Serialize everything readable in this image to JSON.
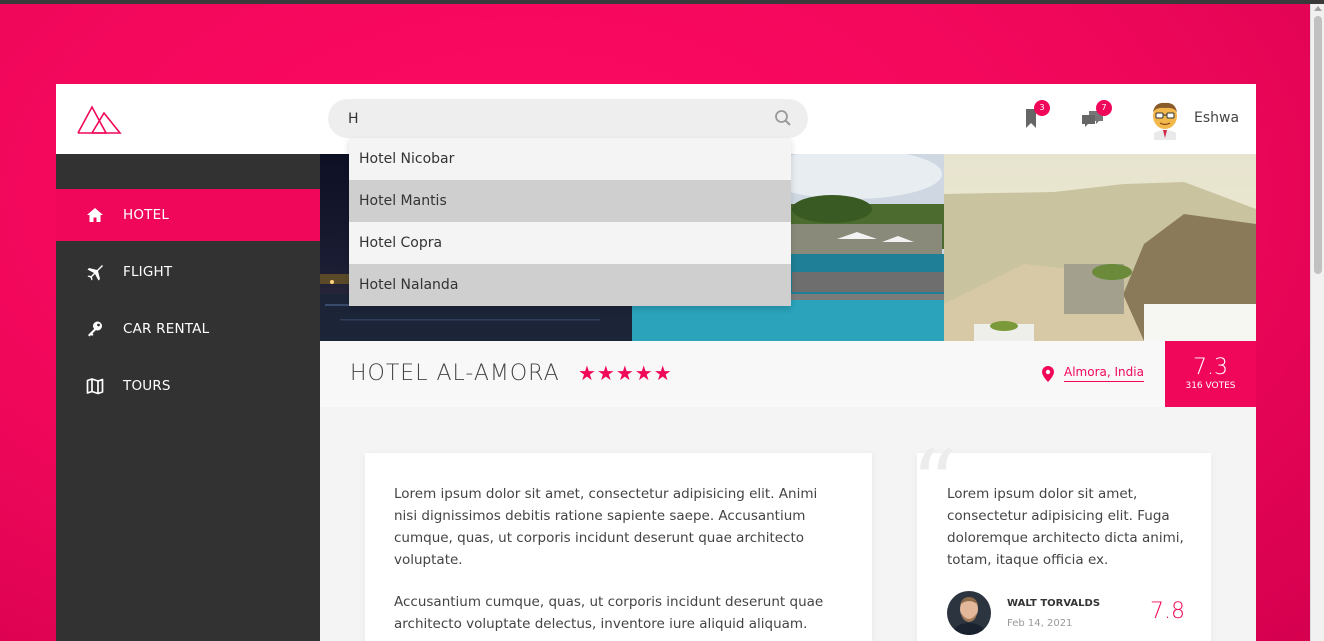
{
  "search": {
    "value": "H",
    "placeholder": ""
  },
  "autocomplete": [
    "Hotel Nicobar",
    "Hotel Mantis",
    "Hotel Copra",
    "Hotel Nalanda"
  ],
  "header": {
    "bookmarks_count": "3",
    "messages_count": "7",
    "username": "Eshwa"
  },
  "sidebar": {
    "items": [
      {
        "label": "HOTEL",
        "icon": "home-icon",
        "active": true
      },
      {
        "label": "FLIGHT",
        "icon": "plane-icon",
        "active": false
      },
      {
        "label": "CAR RENTAL",
        "icon": "key-icon",
        "active": false
      },
      {
        "label": "TOURS",
        "icon": "map-icon",
        "active": false
      }
    ]
  },
  "hotel": {
    "name": "HOTEL AL-AMORA",
    "stars": "★★★★★",
    "star_count": 5,
    "location": "Almora, India",
    "rating": "7.3",
    "votes": "316 VOTES"
  },
  "description": {
    "p1": "Lorem ipsum dolor sit amet, consectetur adipisicing elit. Animi nisi dignissimos debitis ratione sapiente saepe. Accusantium cumque, quas, ut corporis incidunt deserunt quae architecto voluptate.",
    "p2": "Accusantium cumque, quas, ut corporis incidunt deserunt quae architecto voluptate delectus, inventore iure aliquid aliquam."
  },
  "review": {
    "text": "Lorem ipsum dolor sit amet, consectetur adipisicing elit. Fuga doloremque architecto dicta animi, totam, itaque officia ex.",
    "reviewer": "WALT TORVALDS",
    "date": "Feb 14, 2021",
    "score": "7.8"
  },
  "colors": {
    "accent": "#f0075a",
    "sidebar": "#323232"
  }
}
